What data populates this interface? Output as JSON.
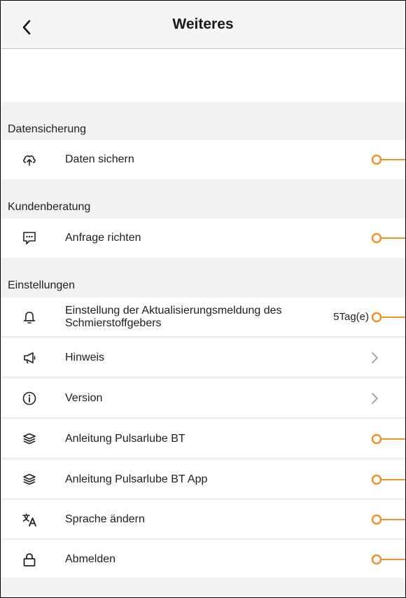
{
  "header": {
    "title": "Weiteres",
    "back_icon": "chevron-left-icon"
  },
  "sections": {
    "backup": {
      "label": "Datensicherung",
      "items": [
        {
          "label": "Daten sichern",
          "icon": "cloud-upload-icon",
          "control": "toggle"
        }
      ]
    },
    "consulting": {
      "label": "Kundenberatung",
      "items": [
        {
          "label": "Anfrage richten",
          "icon": "chat-icon",
          "control": "toggle"
        }
      ]
    },
    "settings": {
      "label": "Einstellungen",
      "items": [
        {
          "label": "Einstellung der Aktualisierungsmeldung des Schmierstoffgebers",
          "icon": "bell-icon",
          "value": "5Tag(e)",
          "control": "toggle"
        },
        {
          "label": "Hinweis",
          "icon": "megaphone-icon",
          "control": "chevron"
        },
        {
          "label": "Version",
          "icon": "info-icon",
          "control": "chevron"
        },
        {
          "label": "Anleitung Pulsarlube BT",
          "icon": "layers-icon",
          "control": "toggle"
        },
        {
          "label": "Anleitung Pulsarlube BT App",
          "icon": "layers-icon",
          "control": "toggle"
        },
        {
          "label": "Sprache ändern",
          "icon": "translate-icon",
          "control": "toggle"
        },
        {
          "label": "Abmelden",
          "icon": "lock-icon",
          "control": "toggle"
        }
      ]
    }
  },
  "colors": {
    "accent": "#f0902a",
    "background": "#f2f2f2",
    "row": "#ffffff",
    "divider": "#e6e6e6"
  }
}
